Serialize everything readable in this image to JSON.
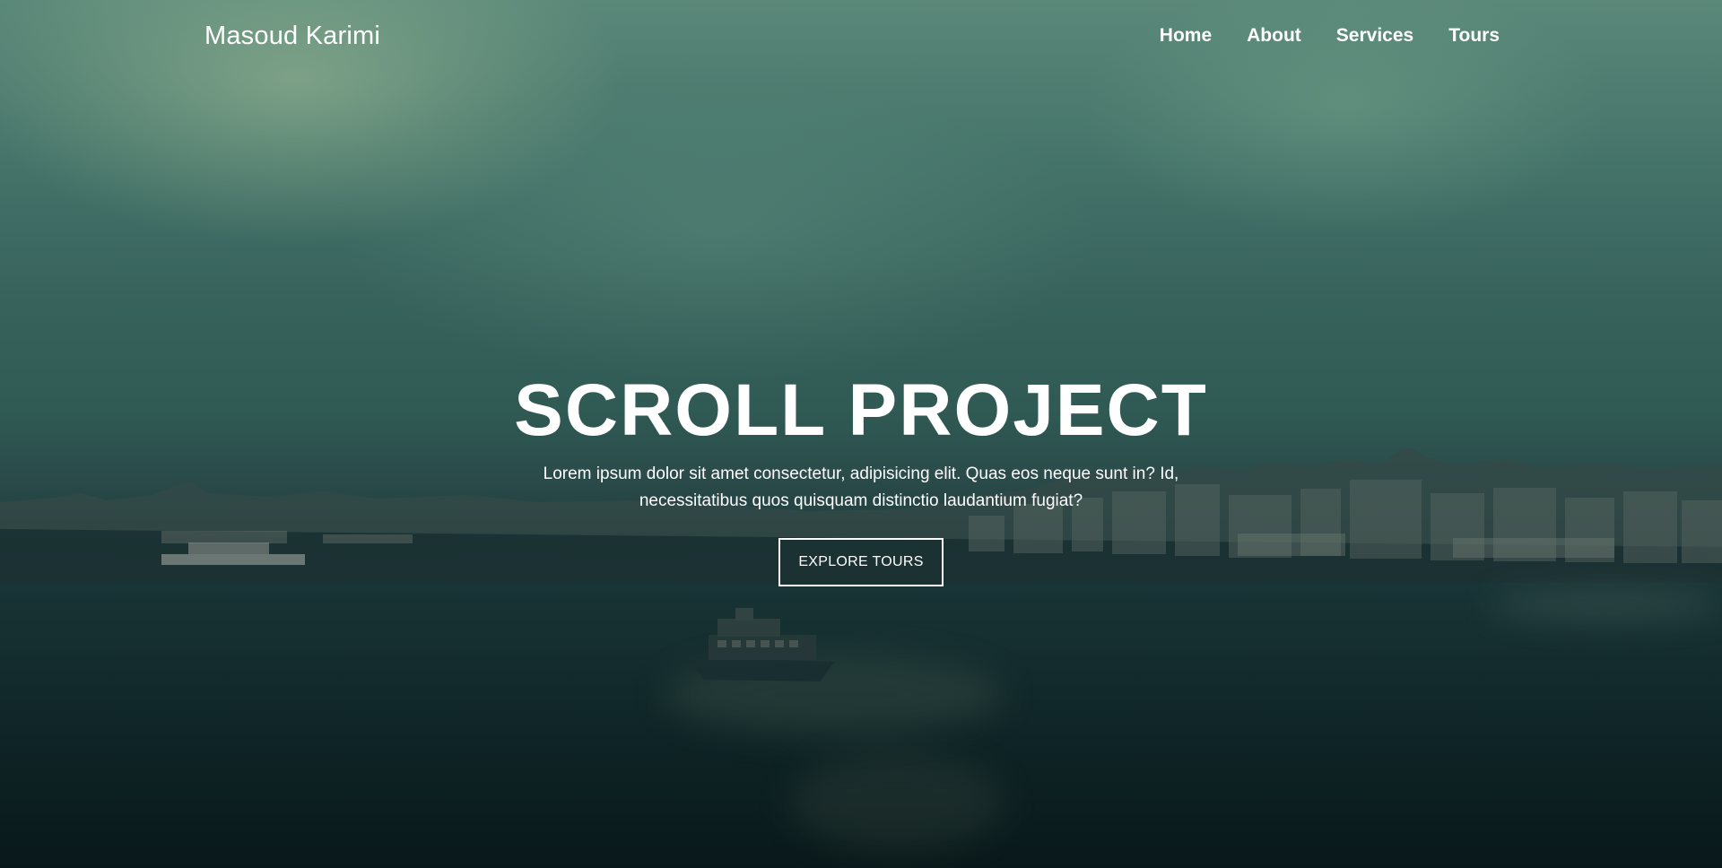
{
  "nav": {
    "brand": "Masoud Karimi",
    "links": [
      {
        "label": "Home"
      },
      {
        "label": "About"
      },
      {
        "label": "Services"
      },
      {
        "label": "Tours"
      }
    ]
  },
  "hero": {
    "title": "SCROLL PROJECT",
    "text": "Lorem ipsum dolor sit amet consectetur, adipisicing elit. Quas eos neque sunt in? Id, necessitatibus quos quisquam distinctio laudantium fugiat?",
    "button_label": "EXPLORE TOURS"
  },
  "colors": {
    "text": "#ffffff",
    "sky": "#4a7b70",
    "water": "#10272a"
  }
}
